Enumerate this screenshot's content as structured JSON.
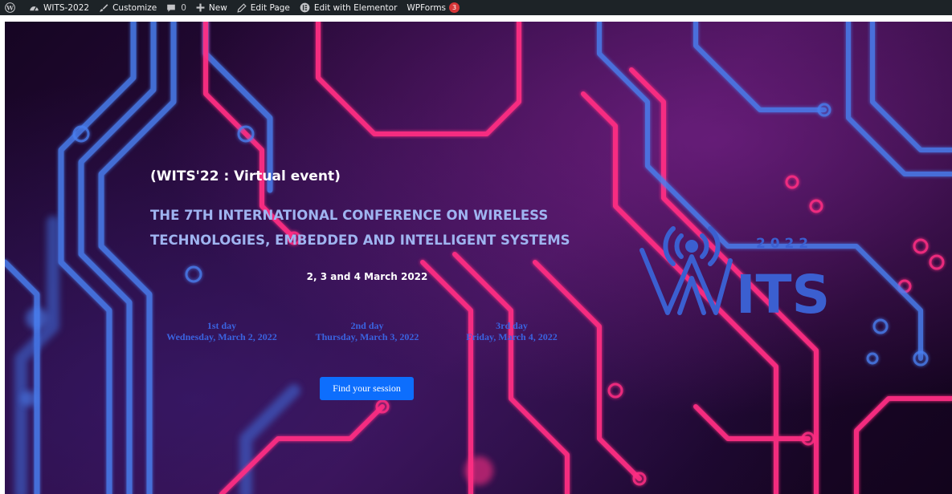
{
  "adminbar": {
    "items": [
      {
        "icon": "wordpress-logo-icon",
        "label": ""
      },
      {
        "icon": "dashboard-icon",
        "label": "WITS-2022"
      },
      {
        "icon": "paintbrush-icon",
        "label": "Customize"
      },
      {
        "icon": "comment-icon",
        "label": "",
        "count": "0"
      },
      {
        "icon": "plus-icon",
        "label": "New"
      },
      {
        "icon": "pencil-icon",
        "label": "Edit Page"
      },
      {
        "icon": "elementor-icon",
        "label": "Edit with Elementor"
      },
      {
        "icon": "",
        "label": "WPForms",
        "badge": "3"
      }
    ]
  },
  "hero": {
    "subtitle": "(WITS'22 : Virtual event)",
    "title_line1": "THE 7TH INTERNATIONAL CONFERENCE ON WIRELESS",
    "title_line2": "TECHNOLOGIES, EMBEDDED AND INTELLIGENT SYSTEMS",
    "dates": "2, 3 and 4 March 2022",
    "days": [
      {
        "label": "1st day",
        "date": "Wednesday, March 2, 2022"
      },
      {
        "label": "2nd day",
        "date": "Thursday, March 3, 2022"
      },
      {
        "label": "3rd day",
        "date": "Friday, March 4, 2022"
      }
    ],
    "cta_label": "Find your session",
    "colors": {
      "accent": "#0d6efd",
      "title": "#9fb4f0",
      "day_text": "#3a63e0",
      "logo": "#3b5fd0"
    }
  },
  "logo": {
    "year": "2 0 2 2",
    "text": "ITS",
    "icon": "radio-tower-icon"
  }
}
